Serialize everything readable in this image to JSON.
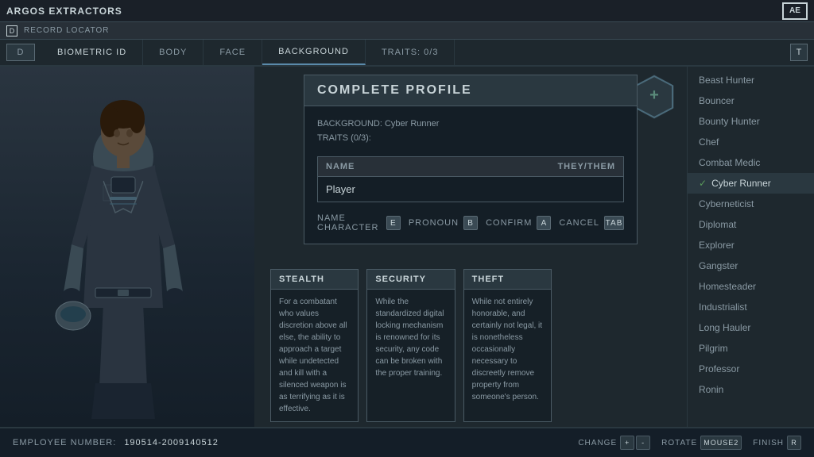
{
  "topbar": {
    "title": "ARGOS EXTRACTORS",
    "logo": "AE"
  },
  "subbar": {
    "badge": "D",
    "text": "RECORD LOCATOR"
  },
  "navbar": {
    "items": [
      {
        "id": "d-badge",
        "label": "D",
        "is_badge": true
      },
      {
        "id": "biometric",
        "label": "BIOMETRIC ID"
      },
      {
        "id": "body",
        "label": "BODY"
      },
      {
        "id": "face",
        "label": "FACE"
      },
      {
        "id": "background",
        "label": "BACKGROUND"
      },
      {
        "id": "traits",
        "label": "TRAITS: 0/3"
      },
      {
        "id": "t-badge",
        "label": "T",
        "is_badge": true
      }
    ]
  },
  "center": {
    "background_title": "Cyber Runner",
    "modal": {
      "header": "COMPLETE PROFILE",
      "background_label": "BACKGROUND: Cyber Runner",
      "traits_label": "TRAITS (0/3):",
      "table": {
        "headers": [
          "NAME",
          "THEY/THEM"
        ],
        "row": [
          "Player",
          ""
        ]
      },
      "actions": [
        {
          "label": "NAME CHARACTER",
          "key": "E"
        },
        {
          "label": "PRONOUN",
          "key": "B"
        },
        {
          "label": "CONFIRM",
          "key": "A"
        },
        {
          "label": "CANCEL",
          "key": "TAB"
        }
      ]
    },
    "cards": [
      {
        "id": "stealth",
        "header": "STEALTH",
        "body": "For a combatant who values discretion above all else, the ability to approach a target while undetected and kill with a silenced weapon is as terrifying as it is effective."
      },
      {
        "id": "security",
        "header": "SECURITY",
        "body": "While the standardized digital locking mechanism is renowned for its security, any code can be broken with the proper training."
      },
      {
        "id": "theft",
        "header": "THEFT",
        "body": "While not entirely honorable, and certainly not legal, it is nonetheless occasionally necessary to discreetly remove property from someone's person."
      }
    ]
  },
  "sidebar": {
    "items": [
      {
        "label": "Beast Hunter",
        "active": false
      },
      {
        "label": "Bouncer",
        "active": false
      },
      {
        "label": "Bounty Hunter",
        "active": false
      },
      {
        "label": "Chef",
        "active": false
      },
      {
        "label": "Combat Medic",
        "active": false
      },
      {
        "label": "Cyber Runner",
        "active": true
      },
      {
        "label": "Cyberneticist",
        "active": false
      },
      {
        "label": "Diplomat",
        "active": false
      },
      {
        "label": "Explorer",
        "active": false
      },
      {
        "label": "Gangster",
        "active": false
      },
      {
        "label": "Homesteader",
        "active": false
      },
      {
        "label": "Industrialist",
        "active": false
      },
      {
        "label": "Long Hauler",
        "active": false
      },
      {
        "label": "Pilgrim",
        "active": false
      },
      {
        "label": "Professor",
        "active": false
      },
      {
        "label": "Ronin",
        "active": false
      }
    ]
  },
  "bottombar": {
    "employee_label": "EMPLOYEE NUMBER:",
    "employee_number": "190514-2009140512",
    "actions": [
      {
        "label": "CHANGE",
        "keys": [
          "+",
          "-"
        ]
      },
      {
        "label": "ROTATE",
        "key": "MOUSE2"
      },
      {
        "label": "FINISH",
        "key": "R"
      }
    ]
  }
}
